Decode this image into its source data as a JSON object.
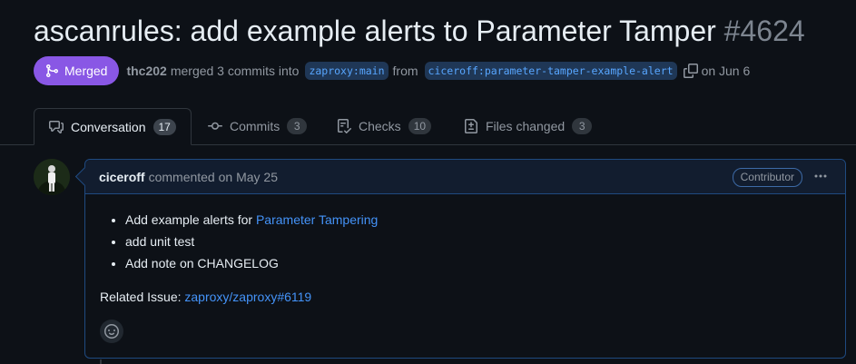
{
  "pr": {
    "title": "ascanrules: add example alerts to Parameter Tamper",
    "number": "#4624",
    "state_label": "Merged",
    "author": "thc202",
    "merged_text": "merged 3 commits into",
    "base_branch": "zaproxy:main",
    "from_text": "from",
    "head_branch": "ciceroff:parameter-tamper-example-alert",
    "date_text": "on Jun 6"
  },
  "tabs": [
    {
      "label": "Conversation",
      "count": "17",
      "icon": "comment-discussion-icon",
      "active": true
    },
    {
      "label": "Commits",
      "count": "3",
      "icon": "git-commit-icon"
    },
    {
      "label": "Checks",
      "count": "10",
      "icon": "checklist-icon"
    },
    {
      "label": "Files changed",
      "count": "3",
      "icon": "file-diff-icon"
    }
  ],
  "comment": {
    "author": "ciceroff",
    "action": "commented on May 25",
    "badge": "Contributor",
    "items": [
      {
        "text": "Add example alerts for ",
        "link": "Parameter Tampering"
      },
      {
        "text": "add unit test"
      },
      {
        "text": "Add note on CHANGELOG"
      }
    ],
    "related_label": "Related Issue:",
    "related_link": "zaproxy/zaproxy#6119"
  },
  "colors": {
    "background": "#0d1117",
    "merged": "#8957e5",
    "link": "#4493f8",
    "comment_border": "#1f4a80"
  }
}
